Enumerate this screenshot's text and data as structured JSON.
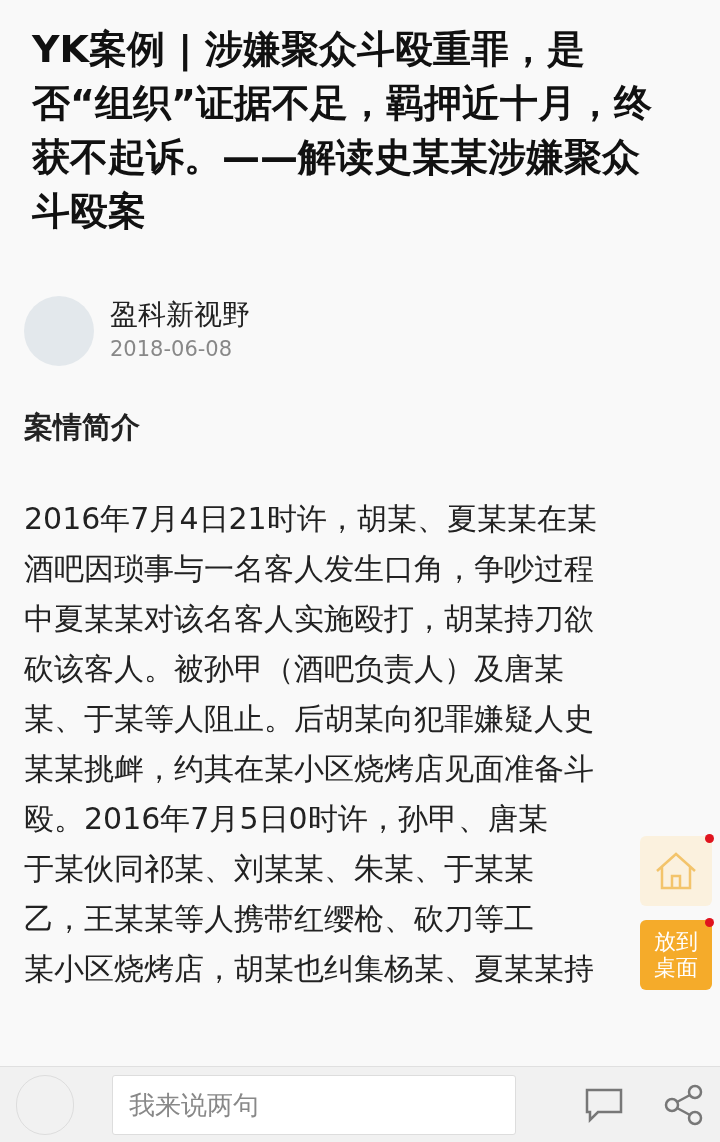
{
  "article": {
    "title": "YK案例 | 涉嫌聚众斗殴重罪，是否“组织”证据不足，羁押近十月，终获不起诉。——解读史某某涉嫌聚众斗殴案",
    "author": {
      "name": "盈科新视野",
      "date": "2018-06-08"
    },
    "section_heading": "案情简介",
    "paragraph_lines": [
      "2016年7月4日21时许，胡某、夏某某在某",
      "酒吧因琐事与一名客人发生口角，争吵过程",
      "中夏某某对该名客人实施殴打，胡某持刀欲",
      "砍该客人。被孙甲（酒吧负责人）及唐某",
      "某、于某等人阻止。后胡某向犯罪嫌疑人史",
      "某某挑衅，约其在某小区烧烤店见面准备斗",
      "殴。2016年7月5日0时许，孙甲、唐某",
      "于某伙同祁某、刘某某、朱某、于某某",
      "乙，王某某等人携带红缨枪、砍刀等工",
      "某小区烧烤店，胡某也纠集杨某、夏某某持"
    ]
  },
  "floating_buttons": [
    {
      "kind": "home",
      "badge": true
    },
    {
      "kind": "text",
      "label": "放到桌面",
      "badge": true
    }
  ],
  "comment_bar": {
    "placeholder": "我来说两句"
  }
}
